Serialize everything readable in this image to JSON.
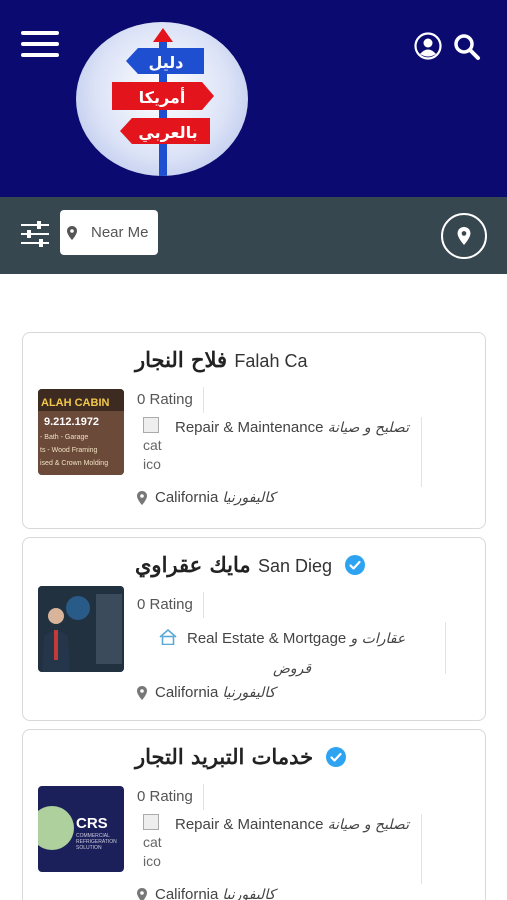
{
  "header": {
    "logo_lines": [
      "دليل",
      "أمريكا",
      "بالعربي"
    ],
    "colors": {
      "background": "#0a0a70",
      "logo_blue_sign": "#1f4fd1",
      "logo_red_sign": "#e3141b"
    },
    "icons": [
      "menu-icon",
      "user-icon",
      "search-icon"
    ]
  },
  "filter_bar": {
    "near_me_label": "Near Me",
    "icons": [
      "filter-sliders-icon",
      "map-pin-icon",
      "location-icon"
    ],
    "background": "#37474f"
  },
  "listings": [
    {
      "title_ar": "فلاح النجار",
      "title_en": "Falah Ca",
      "verified": false,
      "rating": "0 Rating",
      "category_en": "Repair & Maintenance",
      "category_ar": "تصليح و صيانة",
      "category_icon_alt_lines": [
        "cat",
        "ico"
      ],
      "location_en": "California",
      "location_ar": "كاليفورنيا",
      "thumb_text": [
        "ALAH CABIN",
        "9.212.1972",
        "- Bath - Garage",
        "ts - Wood Framing",
        "ised & Crown Molding"
      ]
    },
    {
      "title_ar": "مايك عقراوي",
      "title_en": "San Dieg",
      "verified": true,
      "rating": "0 Rating",
      "category_en": "Real Estate & Mortgage",
      "category_ar_line1": "عقارات و",
      "category_ar_line2": "قروض",
      "location_en": "California",
      "location_ar": "كاليفورنيا"
    },
    {
      "title_ar": "خدمات التبريد التجار",
      "verified": true,
      "rating": "0 Rating",
      "category_en": "Repair & Maintenance",
      "category_ar": "تصليح و صيانة",
      "category_icon_alt_lines": [
        "cat",
        "ico"
      ],
      "location_en": "California",
      "location_ar": "كاليفورنيا",
      "thumb_text": [
        "CRS",
        "COMMERCIAL",
        "REFRIGERATION",
        "SOLUTION"
      ]
    }
  ]
}
